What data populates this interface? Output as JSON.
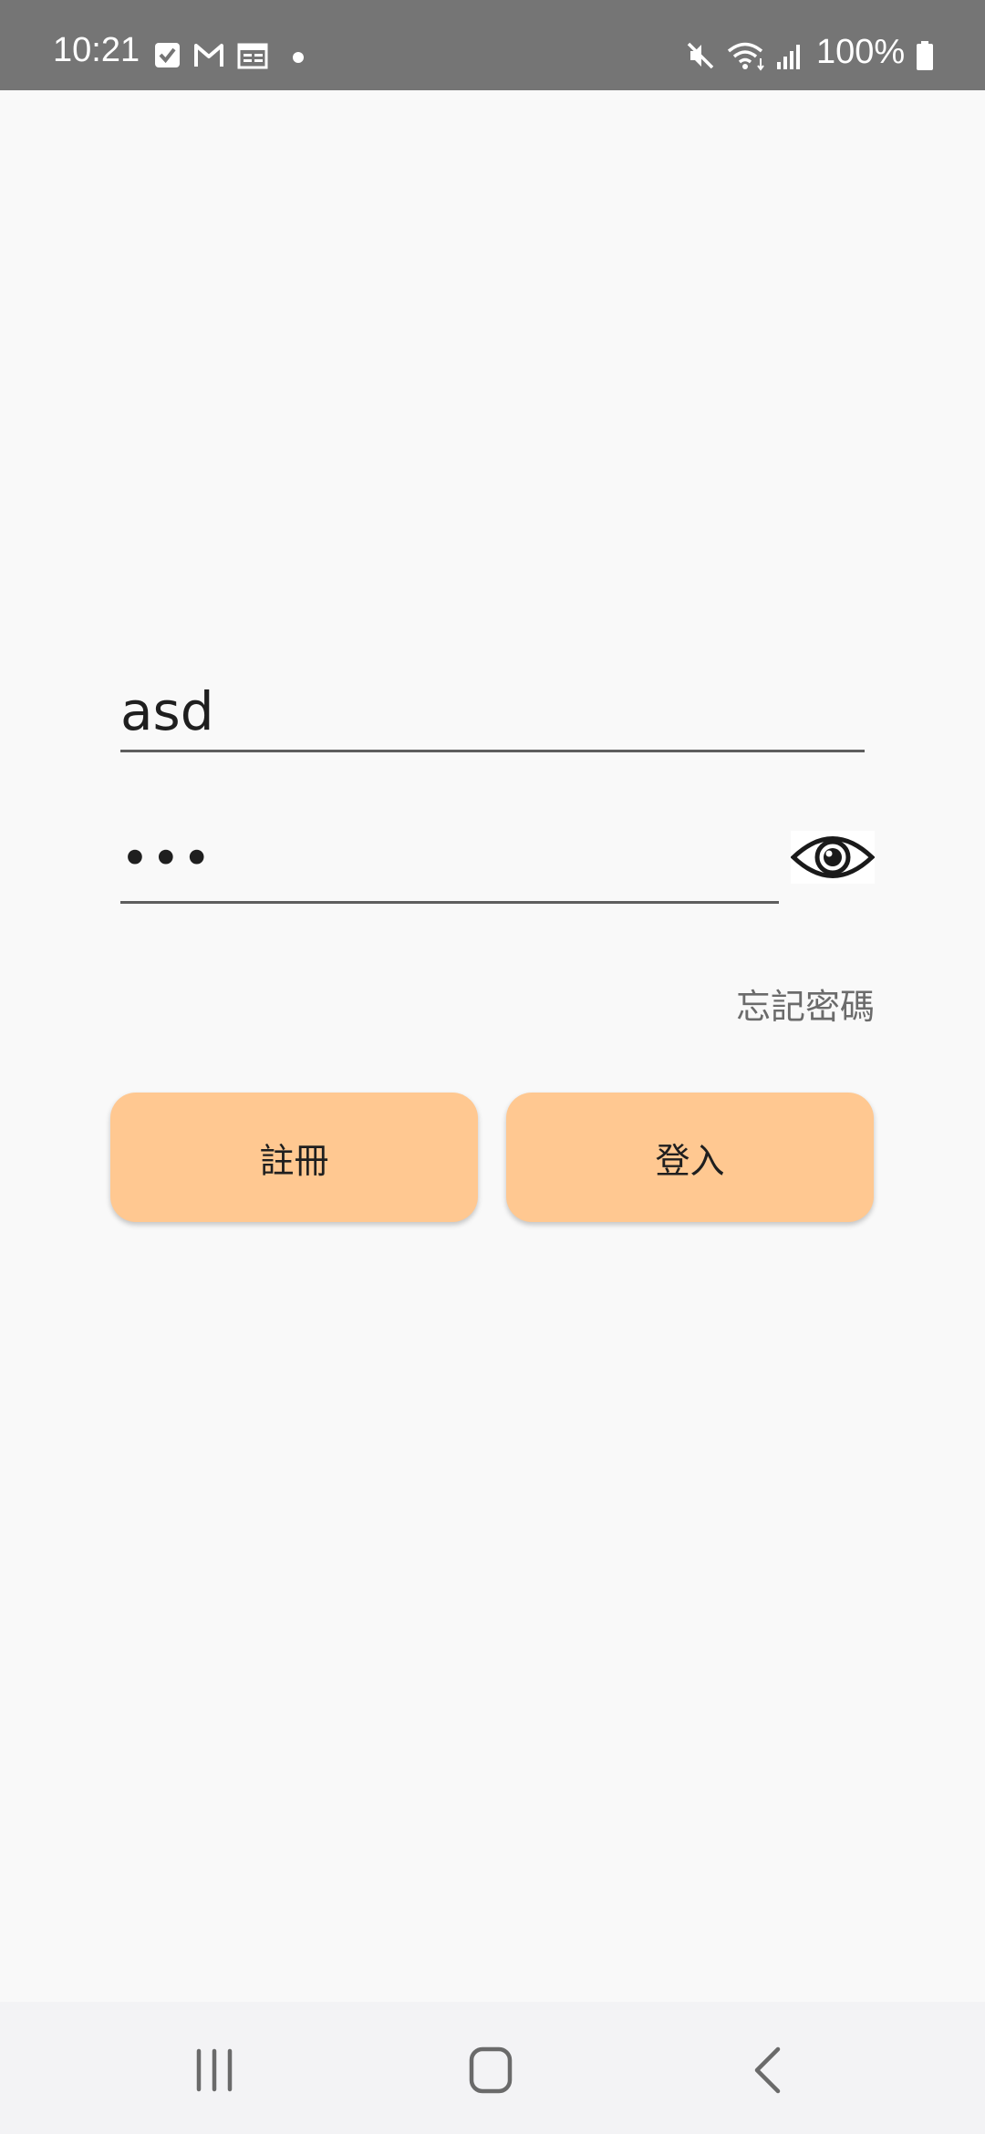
{
  "status_bar": {
    "time": "10:21",
    "battery": "100%",
    "icons": [
      "check-square-icon",
      "gmail-icon",
      "calendar-icon",
      "notification-dot-icon",
      "mute-icon",
      "wifi-icon",
      "signal-icon",
      "battery-icon"
    ]
  },
  "login": {
    "username_value": "asd",
    "password_value": "•••",
    "show_password_icon": "eye-icon",
    "forgot_password": "忘記密碼",
    "register_label": "註冊",
    "login_label": "登入",
    "button_color": "#ffc891"
  },
  "nav_bar": {
    "icons": [
      "recent-apps-icon",
      "home-icon",
      "back-icon"
    ]
  }
}
